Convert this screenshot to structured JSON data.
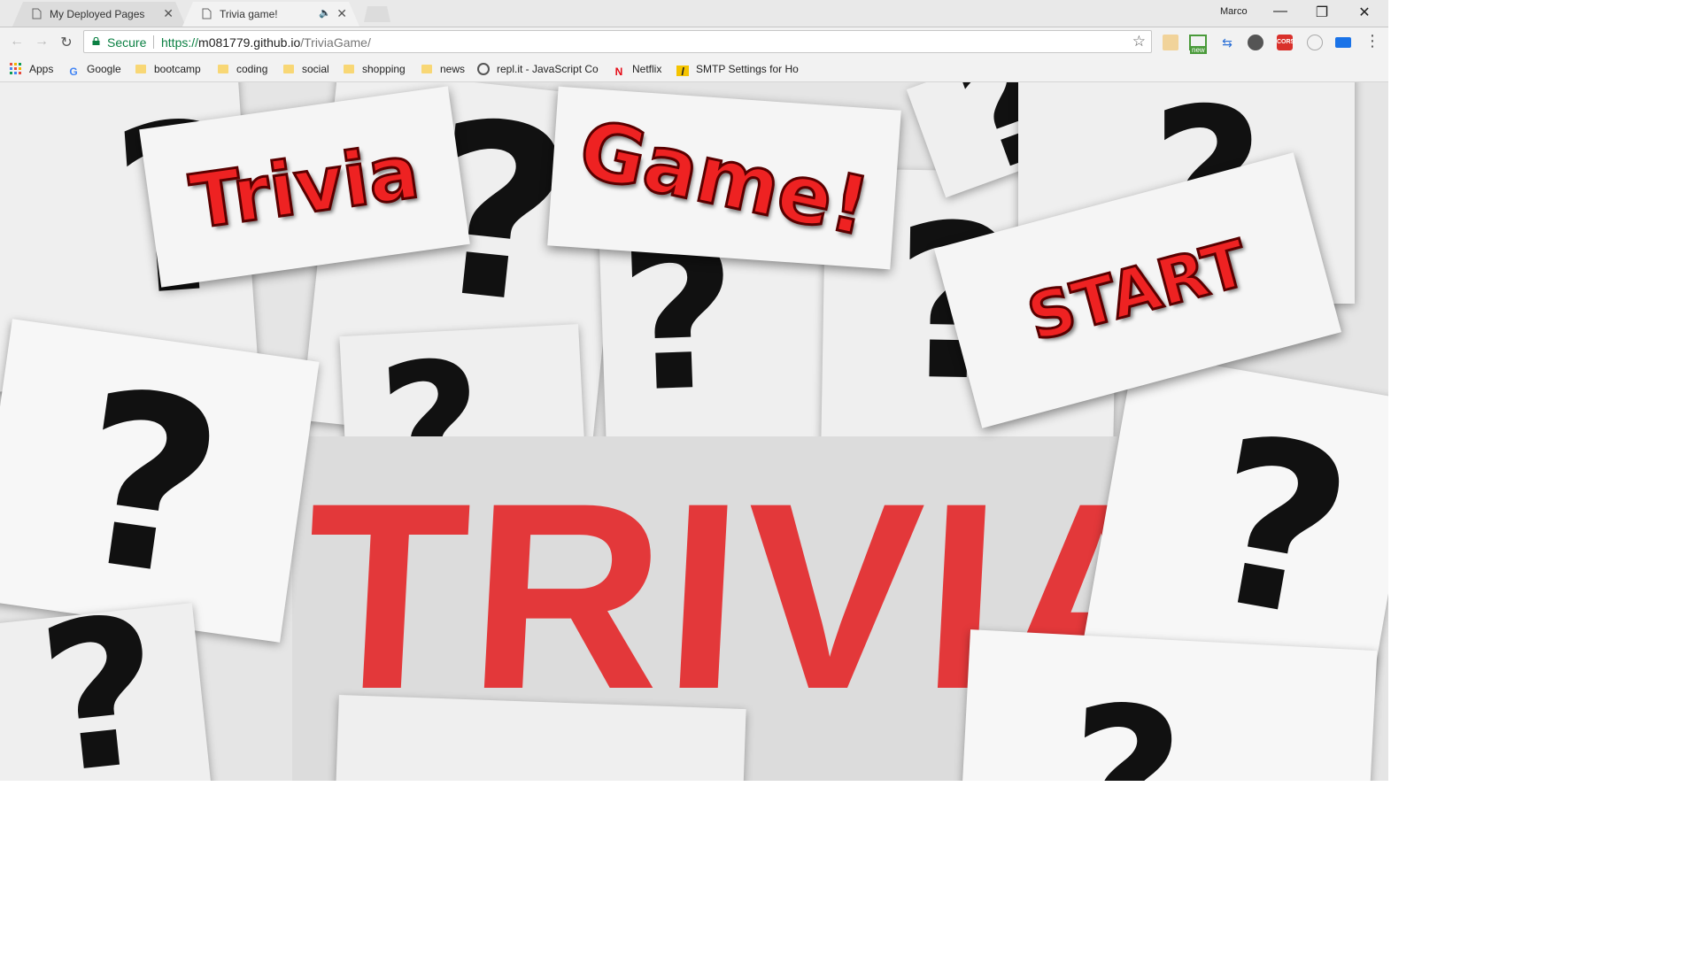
{
  "browser": {
    "tabs": [
      {
        "title": "My Deployed Pages",
        "active": false
      },
      {
        "title": "Trivia game!",
        "active": true
      }
    ],
    "close_glyph": "✕",
    "audio_glyph": "🔈",
    "profile": "Marco",
    "window_controls": {
      "minimize": "—",
      "restore": "❐",
      "close": "✕"
    },
    "nav": {
      "back": "←",
      "forward": "→",
      "reload": "↻"
    },
    "address": {
      "secure_label": "Secure",
      "scheme": "https://",
      "host": "m081779.github.io",
      "path": "/TriviaGame/"
    },
    "star_glyph": "☆",
    "menu_glyph": "⋮",
    "bookmarks": [
      {
        "label": "Apps",
        "icon": "apps-grid-icon"
      },
      {
        "label": "Google",
        "icon": "google-icon"
      },
      {
        "label": "bootcamp",
        "icon": "folder-icon"
      },
      {
        "label": "coding",
        "icon": "folder-icon"
      },
      {
        "label": "social",
        "icon": "folder-icon"
      },
      {
        "label": "shopping",
        "icon": "folder-icon"
      },
      {
        "label": "news",
        "icon": "folder-icon"
      },
      {
        "label": "repl.it - JavaScript Co",
        "icon": "replit-icon"
      },
      {
        "label": "Netflix",
        "icon": "netflix-icon"
      },
      {
        "label": "SMTP Settings for Ho",
        "icon": "smtp-icon"
      }
    ],
    "extensions": [
      "ext-1",
      "ext-new",
      "ext-3",
      "ext-4",
      "ext-cors",
      "ext-6",
      "ext-7"
    ],
    "ext_new_label": "new",
    "ext_cors_label": "CORS"
  },
  "page": {
    "title_word_1": "Trivia",
    "title_word_2": "Game!",
    "start_label": "START",
    "background_word": "TRIVIA",
    "question_glyph": "?"
  },
  "colors": {
    "accent_red": "#e3383a",
    "secure_green": "#0b8043"
  }
}
